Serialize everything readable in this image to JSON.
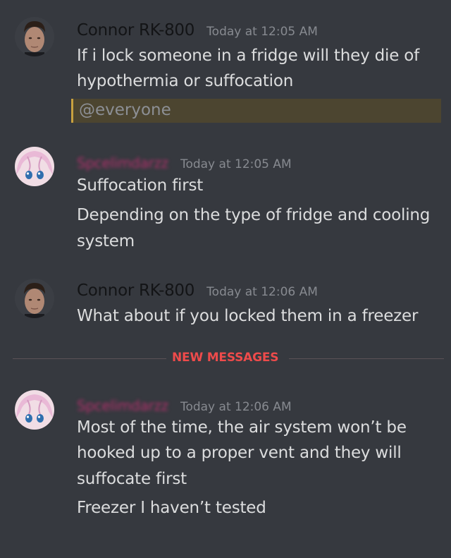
{
  "messages": [
    {
      "author": "Connor RK-800",
      "timestamp": "Today at 12:05 AM",
      "lines": [
        "If i lock someone in a fridge will they die of",
        "hypothermia or suffocation"
      ],
      "mention": "@everyone"
    },
    {
      "author": "Spcelimdarzz",
      "timestamp": "Today at 12:05 AM",
      "lines": [
        "Suffocation first",
        "Depending on the type of fridge and cooling",
        "system"
      ]
    },
    {
      "author": "Connor RK-800",
      "timestamp": "Today at 12:06 AM",
      "lines": [
        "What about if you locked them in a freezer"
      ]
    },
    {
      "author": "Spcelimdarzz",
      "timestamp": "Today at 12:06 AM",
      "lines": [
        "Most of the time, the air system won’t be",
        "hooked up to a proper vent and they will",
        "suffocate first",
        "Freezer I haven’t tested"
      ]
    }
  ],
  "divider": {
    "label": "NEW MESSAGES"
  },
  "colors": {
    "background": "#36393f",
    "message_text": "#dcddde",
    "timestamp": "#878a90",
    "mention_bg": "#4c4530",
    "mention_border": "#c8a13f",
    "new_messages": "#ee4b4b",
    "blurred_username": "#b0306a"
  },
  "icons": {
    "connor_avatar": "connor-avatar-icon",
    "anime_avatar": "anime-girl-avatar-icon"
  }
}
